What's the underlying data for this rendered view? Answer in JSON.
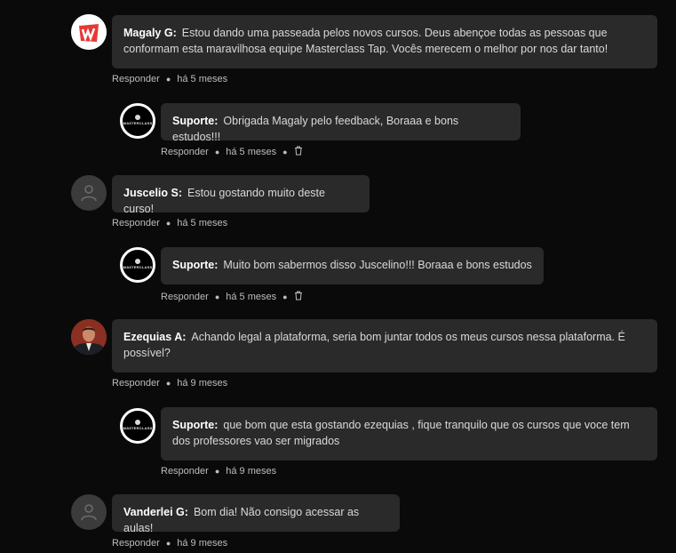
{
  "comments": [
    {
      "author": "Magaly G:",
      "text": "Estou dando uma passeada pelos novos cursos. Deus abençoe todas as pessoas que conformam esta maravilhosa equipe Masterclass Tap. Vocês merecem o melhor por nos dar tanto!",
      "reply_label": "Responder",
      "time": "há 5 meses",
      "avatar": "brand-logo"
    },
    {
      "author": "Suporte:",
      "text": "Obrigada Magaly pelo feedback, Boraaa e bons estudos!!!",
      "reply_label": "Responder",
      "time": "há 5 meses",
      "avatar": "masterclass-logo",
      "deletable": true
    },
    {
      "author": "Juscelio S:",
      "text": "Estou gostando muito deste curso!",
      "reply_label": "Responder",
      "time": "há 5 meses",
      "avatar": "user-icon"
    },
    {
      "author": "Suporte:",
      "text": "Muito bom sabermos disso Juscelino!!! Boraaa e bons estudos",
      "reply_label": "Responder",
      "time": "há 5 meses",
      "avatar": "masterclass-logo",
      "deletable": true
    },
    {
      "author": "Ezequias A:",
      "text": "Achando legal a plataforma, seria bom juntar todos os meus cursos nessa plataforma. É possível?",
      "reply_label": "Responder",
      "time": "há 9 meses",
      "avatar": "user-photo"
    },
    {
      "author": "Suporte:",
      "text": "que bom que esta gostando ezequias , fique tranquilo que os cursos que voce tem dos professores vao ser migrados",
      "reply_label": "Responder",
      "time": "há 9 meses",
      "avatar": "masterclass-logo"
    },
    {
      "author": "Vanderlei G:",
      "text": "Bom dia! Não consigo acessar as aulas!",
      "reply_label": "Responder",
      "time": "há 9 meses",
      "avatar": "user-icon"
    }
  ],
  "logo_text": "MASTERCLASS"
}
